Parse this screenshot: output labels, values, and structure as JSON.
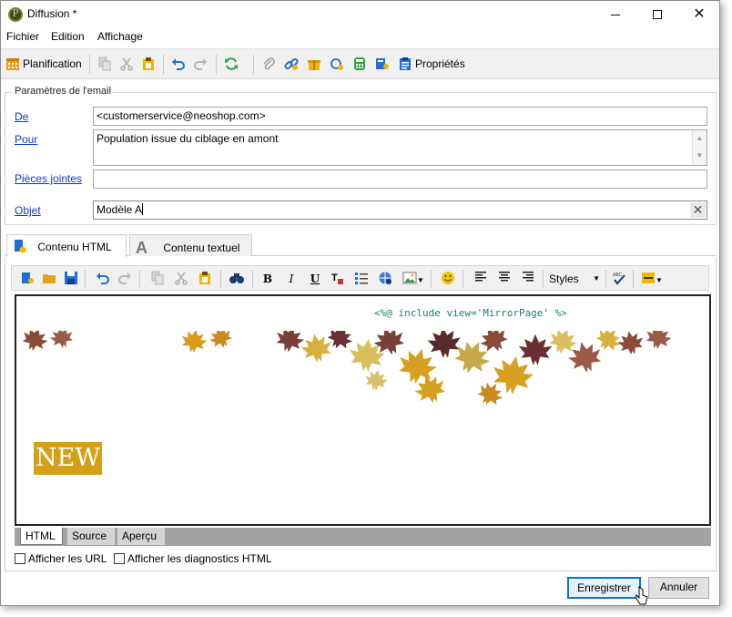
{
  "window": {
    "title": "Diffusion *"
  },
  "menu": [
    "Fichier",
    "Edition",
    "Affichage"
  ],
  "toolbar": {
    "planification_label": "Planification",
    "proprietes_label": "Propriétés"
  },
  "email_params": {
    "legend": "Paramètres de l'email",
    "de_label": "De",
    "de_value": "<customerservice@neoshop.com>",
    "pour_label": "Pour",
    "pour_value": "Population issue du ciblage en amont",
    "pieces_label": "Pièces jointes",
    "pieces_value": "",
    "objet_label": "Objet",
    "objet_value": "Modèle A"
  },
  "tabs": {
    "html_label": "Contenu HTML",
    "text_label": "Contenu textuel"
  },
  "editor": {
    "styles_label": "Styles",
    "include_code": "<%@ include view='MirrorPage' %>",
    "new_badge": "NEW"
  },
  "modes": [
    "HTML",
    "Source",
    "Aperçu"
  ],
  "options": {
    "show_urls": "Afficher les URL",
    "show_diagnostics": "Afficher les diagnostics HTML"
  },
  "buttons": {
    "save": "Enregistrer",
    "cancel": "Annuler"
  },
  "colors": {
    "link_blue": "#0b3ac8",
    "accent_focus": "#0078d7",
    "badge_gold": "#d4a017",
    "code_teal": "#1f7e73"
  }
}
